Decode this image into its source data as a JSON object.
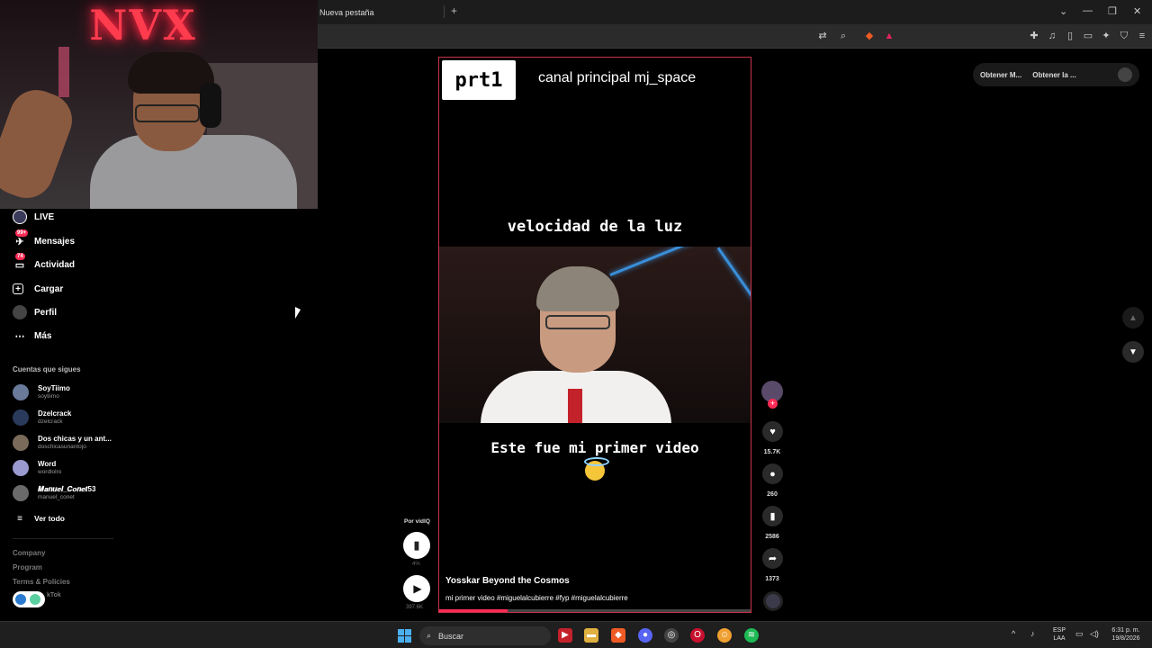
{
  "browser": {
    "tab_title": "Nueva pestaña",
    "new_tab_symbol": "+",
    "window_controls": [
      "⌄",
      "—",
      "❐",
      "✕"
    ]
  },
  "webcam": {
    "neon_sign": "NVX"
  },
  "sidebar": {
    "nav": [
      {
        "label": "LIVE",
        "icon": "live-icon"
      },
      {
        "label": "Mensajes",
        "icon": "messages-icon",
        "badge": "99+"
      },
      {
        "label": "Actividad",
        "icon": "activity-icon",
        "badge": "74"
      },
      {
        "label": "Cargar",
        "icon": "upload-icon"
      },
      {
        "label": "Perfil",
        "icon": "profile-avatar"
      },
      {
        "label": "Más",
        "icon": "more-icon"
      }
    ],
    "following_title": "Cuentas que sigues",
    "following": [
      {
        "name": "SoyTiimo",
        "handle": "soytiimo"
      },
      {
        "name": "Dzelcrack",
        "handle": "dzelcrack"
      },
      {
        "name": "Dos chicas y un ant...",
        "handle": "doschicasunantojo"
      },
      {
        "name": "Word",
        "handle": "wordlolro"
      },
      {
        "name": "𝑴𝒂𝒏𝒖𝒆𝒍_𝑪𝒐𝒏𝒆𝒕53",
        "handle": "manuel_conet"
      }
    ],
    "see_all": "Ver todo",
    "footer": [
      "Company",
      "Program",
      "Terms & Policies"
    ],
    "footer_tail": "kTok"
  },
  "video": {
    "prt_label": "prt1",
    "channel_text": "canal principal mj_space",
    "caption_top": "velocidad de la luz",
    "caption_bottom": "Este fue mi primer video",
    "author": "Yosskar Beyond the Cosmos",
    "description": "mi primer video #miguelalcubierre #fyp #miguelalcubierre",
    "progress": 0.22,
    "accent_color": "#fe2c55"
  },
  "actions": {
    "likes": "15.7K",
    "comments": "260",
    "saves": "2586",
    "shares": "1373"
  },
  "vidiq": {
    "label": "Por vidIQ",
    "sub": "4%",
    "views": "397.6K"
  },
  "top_right": {
    "item1": "Obtener M...",
    "item2": "Obtener la ..."
  },
  "taskbar": {
    "search_label": "Buscar",
    "lang_top": "ESP",
    "lang_bottom": "LAA",
    "time": "6:31 p. m.",
    "date": "19/8/2026"
  }
}
